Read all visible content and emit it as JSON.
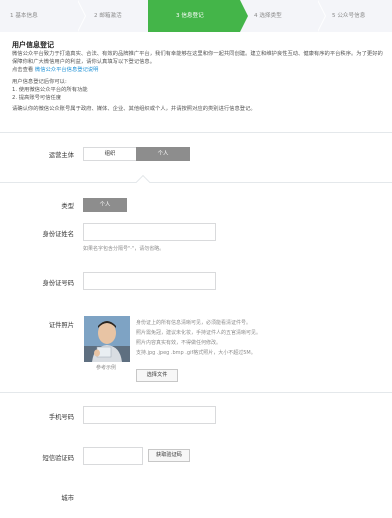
{
  "steps": [
    "1 基本信息",
    "2 邮箱激活",
    "3 信息登记",
    "4 选择类型",
    "5 公众号信息"
  ],
  "intro": {
    "title": "用户信息登记",
    "para": "微信公众平台致力于打造真实、合法、有效的品牌推广平台，我们有幸能够在这里和你一起共同创建。建立和维护良性互动、健康有序的平台秩序。为了更好的保障你和广大微信用户的利益，请你认真填写以下登记信息。",
    "link_prefix": "点击查看",
    "link_text": "微信公众平台信息登记说明",
    "benefits_title": "用户信息登记后你可以:",
    "benefit1": "1. 使用微信公众平台的所有功能",
    "benefit2": "2. 提高账号可信任度",
    "scope": "请确认你的微信公众账号属于政府、媒体、企业、其他组织或个人，并请按照对应的类别进行信息登记。"
  },
  "form": {
    "subject_label": "运营主体",
    "subject_org": "组织",
    "subject_person": "个人",
    "type_label": "类型",
    "type_person": "个人",
    "name_label": "身份证姓名",
    "name_hint": "如果名字包含分隔号\"·\"，请勿省略。",
    "id_label": "身份证号码",
    "photo_label": "证件照片",
    "photo_caption": "参考示例",
    "photo_desc": [
      "身份证上的所有信息清晰可见，必须能看清证件号。",
      "照片需免冠，建议未化妆，手持证件人的五官清晰可见。",
      "照片内容真实有效，不得做任何修改。",
      "支持.jpg .jpeg .bmp .gif格式照片，大小不超过5M。"
    ],
    "choose_file": "选择文件",
    "phone_label": "手机号码",
    "sms_label": "短信验证码",
    "sms_button": "获取验证码",
    "city_label": "城市"
  }
}
